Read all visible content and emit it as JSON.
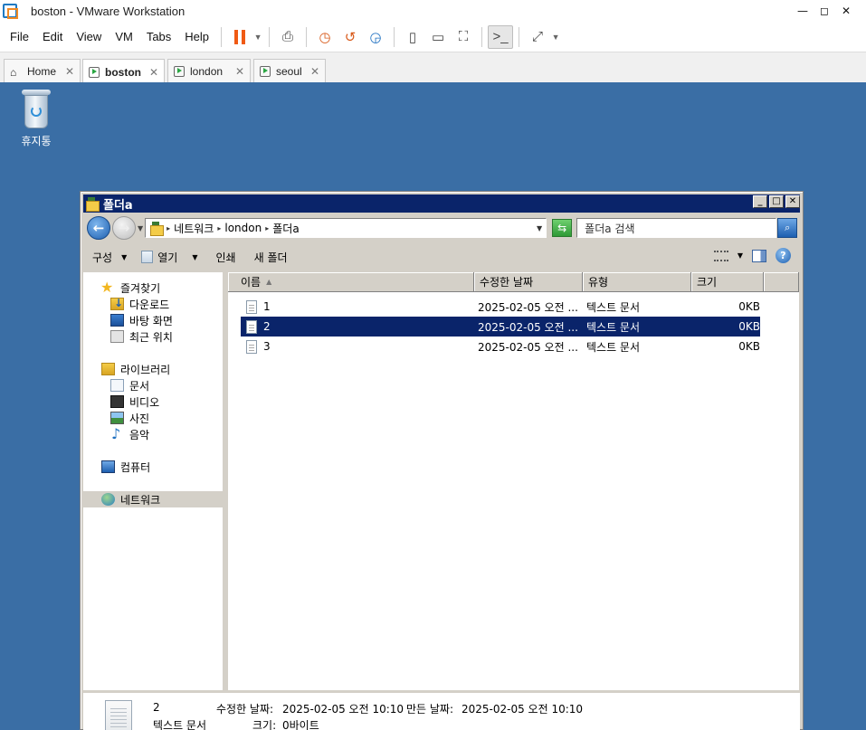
{
  "host": {
    "title": "boston - VMware Workstation",
    "menu": [
      "File",
      "Edit",
      "View",
      "VM",
      "Tabs",
      "Help"
    ],
    "tabs": [
      {
        "label": "Home"
      },
      {
        "label": "boston"
      },
      {
        "label": "london"
      },
      {
        "label": "seoul"
      }
    ]
  },
  "desktop": {
    "recycle_bin": "휴지통",
    "background": "#3a6ea5"
  },
  "explorer": {
    "title": "폴더a",
    "breadcrumb": [
      "네트워크",
      "london",
      "폴더a"
    ],
    "search_placeholder": "폴더a 검색",
    "commands": {
      "organize": "구성",
      "open": "열기",
      "print": "인쇄",
      "new_folder": "새 폴더"
    },
    "nav": {
      "favorites": "즐겨찾기",
      "downloads": "다운로드",
      "desktop": "바탕 화면",
      "recent": "최근 위치",
      "libraries": "라이브러리",
      "documents": "문서",
      "videos": "비디오",
      "pictures": "사진",
      "music": "음악",
      "computer": "컴퓨터",
      "network": "네트워크"
    },
    "columns": {
      "name": "이름",
      "modified": "수정한 날짜",
      "type": "유형",
      "size": "크기"
    },
    "files": [
      {
        "name": "1",
        "modified": "2025-02-05 오전 ...",
        "type": "텍스트 문서",
        "size": "0KB"
      },
      {
        "name": "2",
        "modified": "2025-02-05 오전 ...",
        "type": "텍스트 문서",
        "size": "0KB"
      },
      {
        "name": "3",
        "modified": "2025-02-05 오전 ...",
        "type": "텍스트 문서",
        "size": "0KB"
      }
    ],
    "details": {
      "name": "2",
      "type": "텍스트 문서",
      "modified_label": "수정한 날짜:",
      "modified_value": "2025-02-05 오전 10:10",
      "created_label": "만든 날짜:",
      "created_value": "2025-02-05 오전 10:10",
      "size_label": "크기:",
      "size_value": "0바이트"
    }
  }
}
